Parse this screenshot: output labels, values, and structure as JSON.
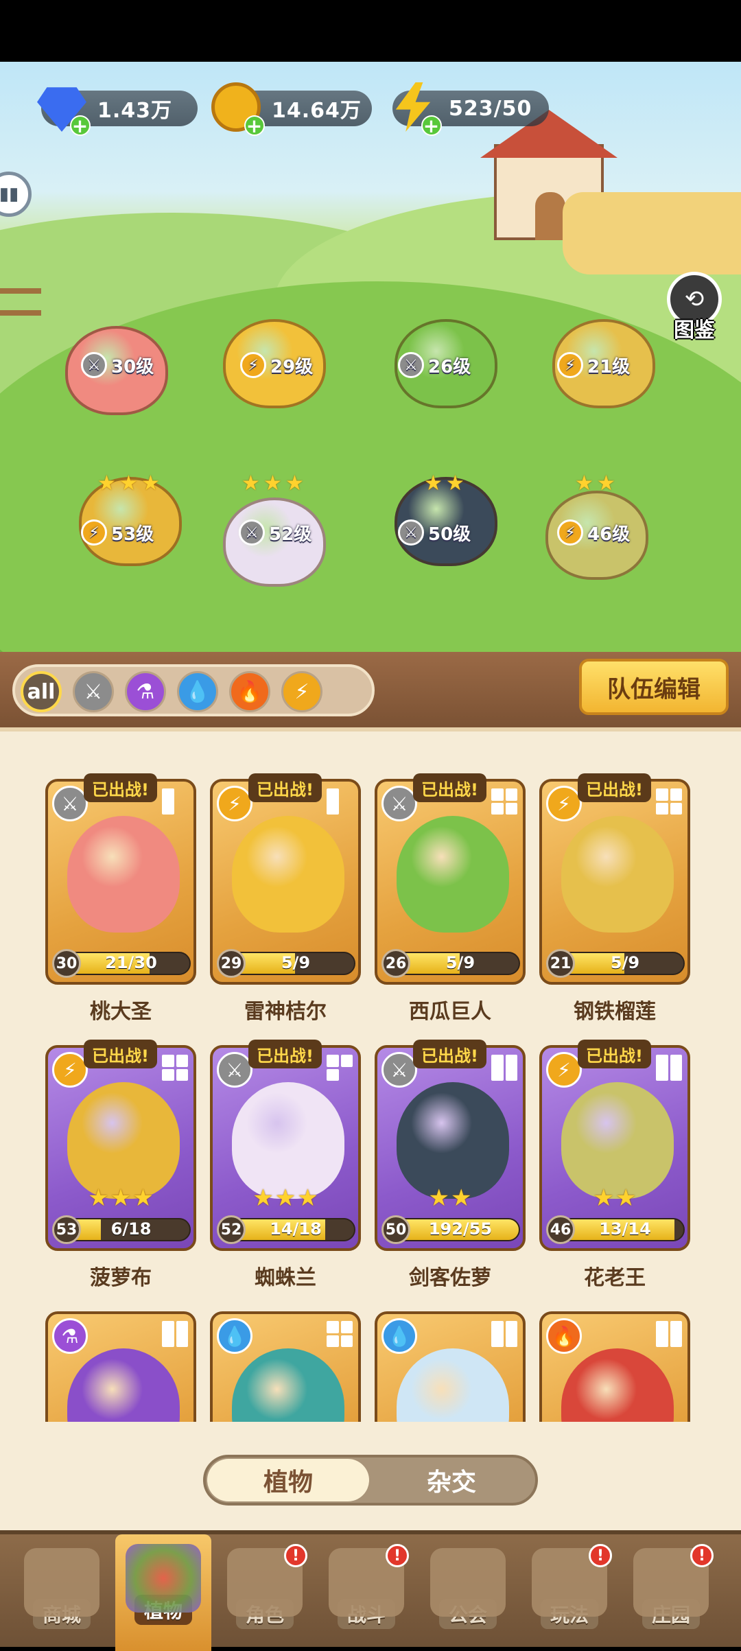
{
  "resources": [
    {
      "name": "gems",
      "value": "1.43万",
      "color": "#3a6cf0",
      "icon": "diamond-icon"
    },
    {
      "name": "gold",
      "value": "14.64万",
      "color": "#f0b21c",
      "icon": "coin-icon"
    },
    {
      "name": "energy",
      "value": "523/50",
      "color": "#f5c51c",
      "icon": "lightning-icon"
    }
  ],
  "atlas_label": "图鉴",
  "field_units": [
    {
      "level": "30级",
      "type": "sword",
      "stars": 0
    },
    {
      "level": "29级",
      "type": "lightning",
      "stars": 0
    },
    {
      "level": "26级",
      "type": "sword",
      "stars": 0
    },
    {
      "level": "21级",
      "type": "lightning",
      "stars": 0
    },
    {
      "level": "53级",
      "type": "lightning",
      "stars": 3
    },
    {
      "level": "52级",
      "type": "sword",
      "stars": 3
    },
    {
      "level": "50级",
      "type": "sword",
      "stars": 2
    },
    {
      "level": "46级",
      "type": "lightning",
      "stars": 2
    }
  ],
  "filters": [
    {
      "label": "all",
      "type": "all",
      "selected": true
    },
    {
      "label": "",
      "type": "sword",
      "icon": "sword-icon"
    },
    {
      "label": "",
      "type": "potion",
      "icon": "potion-icon"
    },
    {
      "label": "",
      "type": "water",
      "icon": "water-drop-icon"
    },
    {
      "label": "",
      "type": "fire",
      "icon": "fire-icon"
    },
    {
      "label": "",
      "type": "lightning",
      "icon": "lightning-icon"
    }
  ],
  "team_edit_label": "队伍编辑",
  "deployed_label": "已出战!",
  "cards": [
    {
      "name": "桃大圣",
      "level": "30",
      "progress": "21/30",
      "fill": 0.7,
      "rarity": "gold",
      "type": "sword",
      "stars": 0,
      "deployed": true,
      "slots": 1,
      "portrait": "#f08a80"
    },
    {
      "name": "雷神桔尔",
      "level": "29",
      "progress": "5/9",
      "fill": 0.55,
      "rarity": "gold",
      "type": "lightning",
      "stars": 0,
      "deployed": true,
      "slots": 1,
      "portrait": "#f2c13a"
    },
    {
      "name": "西瓜巨人",
      "level": "26",
      "progress": "5/9",
      "fill": 0.55,
      "rarity": "gold",
      "type": "sword",
      "stars": 0,
      "deployed": true,
      "slots": 4,
      "portrait": "#7cc24a"
    },
    {
      "name": "钢铁榴莲",
      "level": "21",
      "progress": "5/9",
      "fill": 0.55,
      "rarity": "gold",
      "type": "lightning",
      "stars": 0,
      "deployed": true,
      "slots": 4,
      "portrait": "#e6c04c"
    },
    {
      "name": "菠萝布",
      "level": "53",
      "progress": "6/18",
      "fill": 0.33,
      "rarity": "purple",
      "type": "lightning",
      "stars": 3,
      "deployed": true,
      "slots": 4,
      "portrait": "#e8b73a"
    },
    {
      "name": "蜘蛛兰",
      "level": "52",
      "progress": "14/18",
      "fill": 0.78,
      "rarity": "purple",
      "type": "sword",
      "stars": 3,
      "deployed": true,
      "slots": 3,
      "portrait": "#f0e4f5"
    },
    {
      "name": "剑客佐萝",
      "level": "50",
      "progress": "192/55",
      "fill": 1,
      "rarity": "purple",
      "type": "sword",
      "stars": 2,
      "deployed": true,
      "slots": 2,
      "portrait": "#3b4a5a"
    },
    {
      "name": "花老王",
      "level": "46",
      "progress": "13/14",
      "fill": 0.93,
      "rarity": "purple",
      "type": "lightning",
      "stars": 2,
      "deployed": true,
      "slots": 2,
      "portrait": "#c9c36a"
    },
    {
      "name": "",
      "level": "",
      "progress": "",
      "fill": 0,
      "rarity": "gold",
      "type": "potion",
      "stars": 0,
      "deployed": false,
      "slots": 2,
      "portrait": "#8a4fc9"
    },
    {
      "name": "",
      "level": "",
      "progress": "",
      "fill": 0,
      "rarity": "gold",
      "type": "water",
      "stars": 0,
      "deployed": false,
      "slots": 4,
      "portrait": "#3fa6a0"
    },
    {
      "name": "",
      "level": "",
      "progress": "",
      "fill": 0,
      "rarity": "gold",
      "type": "water",
      "stars": 0,
      "deployed": false,
      "slots": 2,
      "portrait": "#cfe6f5"
    },
    {
      "name": "",
      "level": "",
      "progress": "",
      "fill": 0,
      "rarity": "gold",
      "type": "fire",
      "stars": 0,
      "deployed": false,
      "slots": 2,
      "portrait": "#d9473a"
    }
  ],
  "mode_toggle": {
    "plant": "植物",
    "cross": "杂交",
    "selected": "plant"
  },
  "nav": [
    {
      "label": "商城",
      "badge": false,
      "active": false
    },
    {
      "label": "植物",
      "badge": false,
      "active": true
    },
    {
      "label": "角色",
      "badge": true,
      "active": false
    },
    {
      "label": "战斗",
      "badge": true,
      "active": false
    },
    {
      "label": "公会",
      "badge": false,
      "active": false
    },
    {
      "label": "玩法",
      "badge": true,
      "active": false
    },
    {
      "label": "庄园",
      "badge": true,
      "active": false
    }
  ],
  "nav_badge_symbol": "!",
  "type_colors": {
    "sword": "#8c8c8c",
    "lightning": "#f0a81c",
    "potion": "#9b4fd6",
    "water": "#3a9be6",
    "fire": "#f06a1c",
    "all": "#f0b21c"
  },
  "type_glyphs": {
    "sword": "⚔",
    "lightning": "⚡",
    "potion": "⚗",
    "water": "💧",
    "fire": "🔥",
    "all": "all"
  }
}
